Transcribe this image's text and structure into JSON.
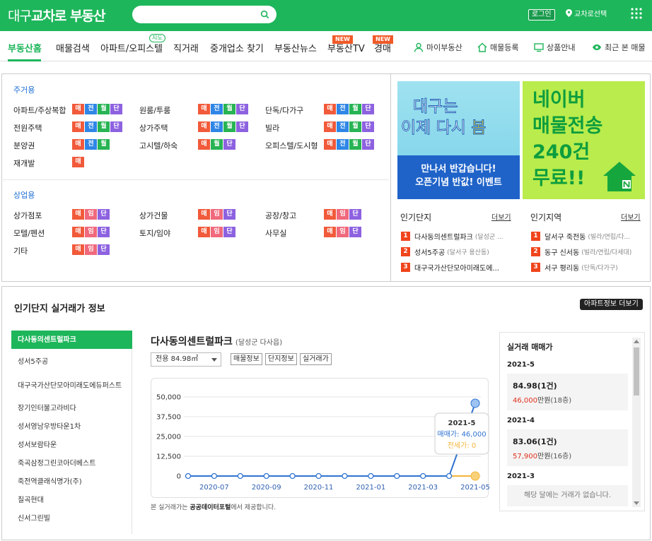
{
  "header": {
    "logo_prefix": "대구",
    "logo_brand": "교차로 부동산",
    "search_placeholder": "",
    "login_label": "로그인",
    "location_label": "교차로선택"
  },
  "nav": {
    "items": [
      "부동산홈",
      "매물검색",
      "아파트/오피스텔",
      "직거래",
      "중개업소 찾기",
      "부동산뉴스",
      "부동산TV",
      "경매"
    ],
    "map_badge": "지도",
    "new_badge": "NEW",
    "utils": [
      "마이부동산",
      "매물등록",
      "상품안내",
      "최근 본 매물"
    ]
  },
  "categories": {
    "residential_title": "주거용",
    "commercial_title": "상업용",
    "residential": [
      {
        "label": "아파트/주상복합",
        "tags": [
          "매",
          "전",
          "월",
          "단"
        ]
      },
      {
        "label": "원룸/투룸",
        "tags": [
          "매",
          "전",
          "월",
          "단"
        ]
      },
      {
        "label": "단독/다가구",
        "tags": [
          "매",
          "전",
          "월",
          "단"
        ]
      },
      {
        "label": "전원주택",
        "tags": [
          "매",
          "전",
          "월",
          "단"
        ]
      },
      {
        "label": "상가주택",
        "tags": [
          "매",
          "전",
          "월",
          "단"
        ]
      },
      {
        "label": "빌라",
        "tags": [
          "매",
          "전",
          "월",
          "단"
        ]
      },
      {
        "label": "분양권",
        "tags": [
          "매",
          "전",
          "월"
        ]
      },
      {
        "label": "고시텔/하숙",
        "tags": [
          "매",
          "월",
          "단"
        ]
      },
      {
        "label": "오피스텔/도시형",
        "tags": [
          "매",
          "전",
          "월",
          "단"
        ]
      },
      {
        "label": "재개발",
        "tags": [
          "매"
        ]
      }
    ],
    "commercial": [
      {
        "label": "상가점포",
        "tags": [
          "매",
          "임",
          "단"
        ]
      },
      {
        "label": "상가건물",
        "tags": [
          "매",
          "임",
          "단"
        ]
      },
      {
        "label": "공장/창고",
        "tags": [
          "매",
          "임",
          "단"
        ]
      },
      {
        "label": "모텔/펜션",
        "tags": [
          "매",
          "임",
          "단"
        ]
      },
      {
        "label": "토지/임야",
        "tags": [
          "매",
          "임",
          "단"
        ]
      },
      {
        "label": "사무실",
        "tags": [
          "매",
          "임",
          "단"
        ]
      },
      {
        "label": "기타",
        "tags": [
          "매",
          "임",
          "단"
        ]
      }
    ]
  },
  "banners": {
    "b1_line1": "대구는",
    "b1_line2a": "이제 다시 ",
    "b1_line2b": "봄",
    "b1_l1": "만나서 반갑습니다!",
    "b1_l2": "오픈기념 반값! 이벤트",
    "b2_l1": "네이버",
    "b2_l2": "매물전송",
    "b2_l3": "240건",
    "b2_l4": "무료!!"
  },
  "popular": {
    "complex_title": "인기단지",
    "region_title": "인기지역",
    "more": "더보기",
    "complexes": [
      {
        "rank": "1",
        "name": "다사동의센트럴파크",
        "sub": "(달성군 ..."
      },
      {
        "rank": "2",
        "name": "성서5주공",
        "sub": "(달서구 용산동)"
      },
      {
        "rank": "3",
        "name": "대구국가산단모아미래도에...",
        "sub": ""
      }
    ],
    "regions": [
      {
        "rank": "1",
        "name": "달서구 죽전동",
        "sub": "(빌라/연립/다..."
      },
      {
        "rank": "2",
        "name": "동구 신서동",
        "sub": "(빌라/연립/다세대)"
      },
      {
        "rank": "3",
        "name": "서구 평리동",
        "sub": "(단독/다가구)"
      }
    ]
  },
  "realprice": {
    "section_title": "인기단지 실거래가 정보",
    "apt_more": "아파트정보 더보기",
    "apt_list": [
      "다사동의센트럴파크",
      "성서5주공",
      "대구국가산단모아미래도에듀퍼스트",
      "장기인터불고라비다",
      "성서영남우방타운1차",
      "성서보람타운",
      "죽곡삼정그린코아더베스트",
      "죽전역클래식명가(주)",
      "칠곡현대",
      "신서그린빌"
    ],
    "detail_name": "다사동의센트럴파크",
    "detail_loc": "(달성군 다사읍)",
    "select_value": "전용 84.98㎡",
    "buttons": [
      "매물정보",
      "단지정보",
      "실거래가"
    ],
    "note_prefix": "본 실거래가는 ",
    "note_bold": "공공데이터포털",
    "note_suffix": "에서 제공합니다.",
    "tooltip": {
      "month": "2021-5",
      "sale": "매매가: 46,000",
      "jeonse": "전세가: 0"
    },
    "trade_title": "실거래 매매가",
    "trades": [
      {
        "month": "2021-5",
        "main": "84.98(1건)",
        "price_red": "46,000",
        "price_unit": "만원",
        "floor": "(18층)"
      },
      {
        "month": "2021-4",
        "main": "83.06(1건)",
        "price_red": "57,900",
        "price_unit": "만원",
        "floor": "(16층)"
      },
      {
        "month": "2021-3",
        "empty": "해당 달에는 거래가 없습니다."
      }
    ]
  },
  "colors": {
    "brand": "#1eb65b",
    "sale_line": "#2f73d0",
    "jeonse_line": "#f5b43a"
  },
  "chart_data": {
    "type": "line",
    "x": [
      "2020-06",
      "2020-07",
      "2020-08",
      "2020-09",
      "2020-10",
      "2020-11",
      "2020-12",
      "2021-01",
      "2021-02",
      "2021-03",
      "2021-04",
      "2021-05"
    ],
    "x_tick_labels": [
      "2020-07",
      "2020-09",
      "2020-11",
      "2021-01",
      "2021-03",
      "2021-05"
    ],
    "y_tick_labels": [
      "50,000",
      "37,500",
      "25,000",
      "12,500",
      "0"
    ],
    "ylim": [
      0,
      50000
    ],
    "series": [
      {
        "name": "매매가",
        "values": [
          0,
          0,
          0,
          0,
          0,
          0,
          0,
          0,
          0,
          0,
          0,
          46000
        ]
      },
      {
        "name": "전세가",
        "values": [
          null,
          null,
          null,
          null,
          null,
          null,
          null,
          null,
          null,
          null,
          0,
          0
        ]
      }
    ]
  }
}
